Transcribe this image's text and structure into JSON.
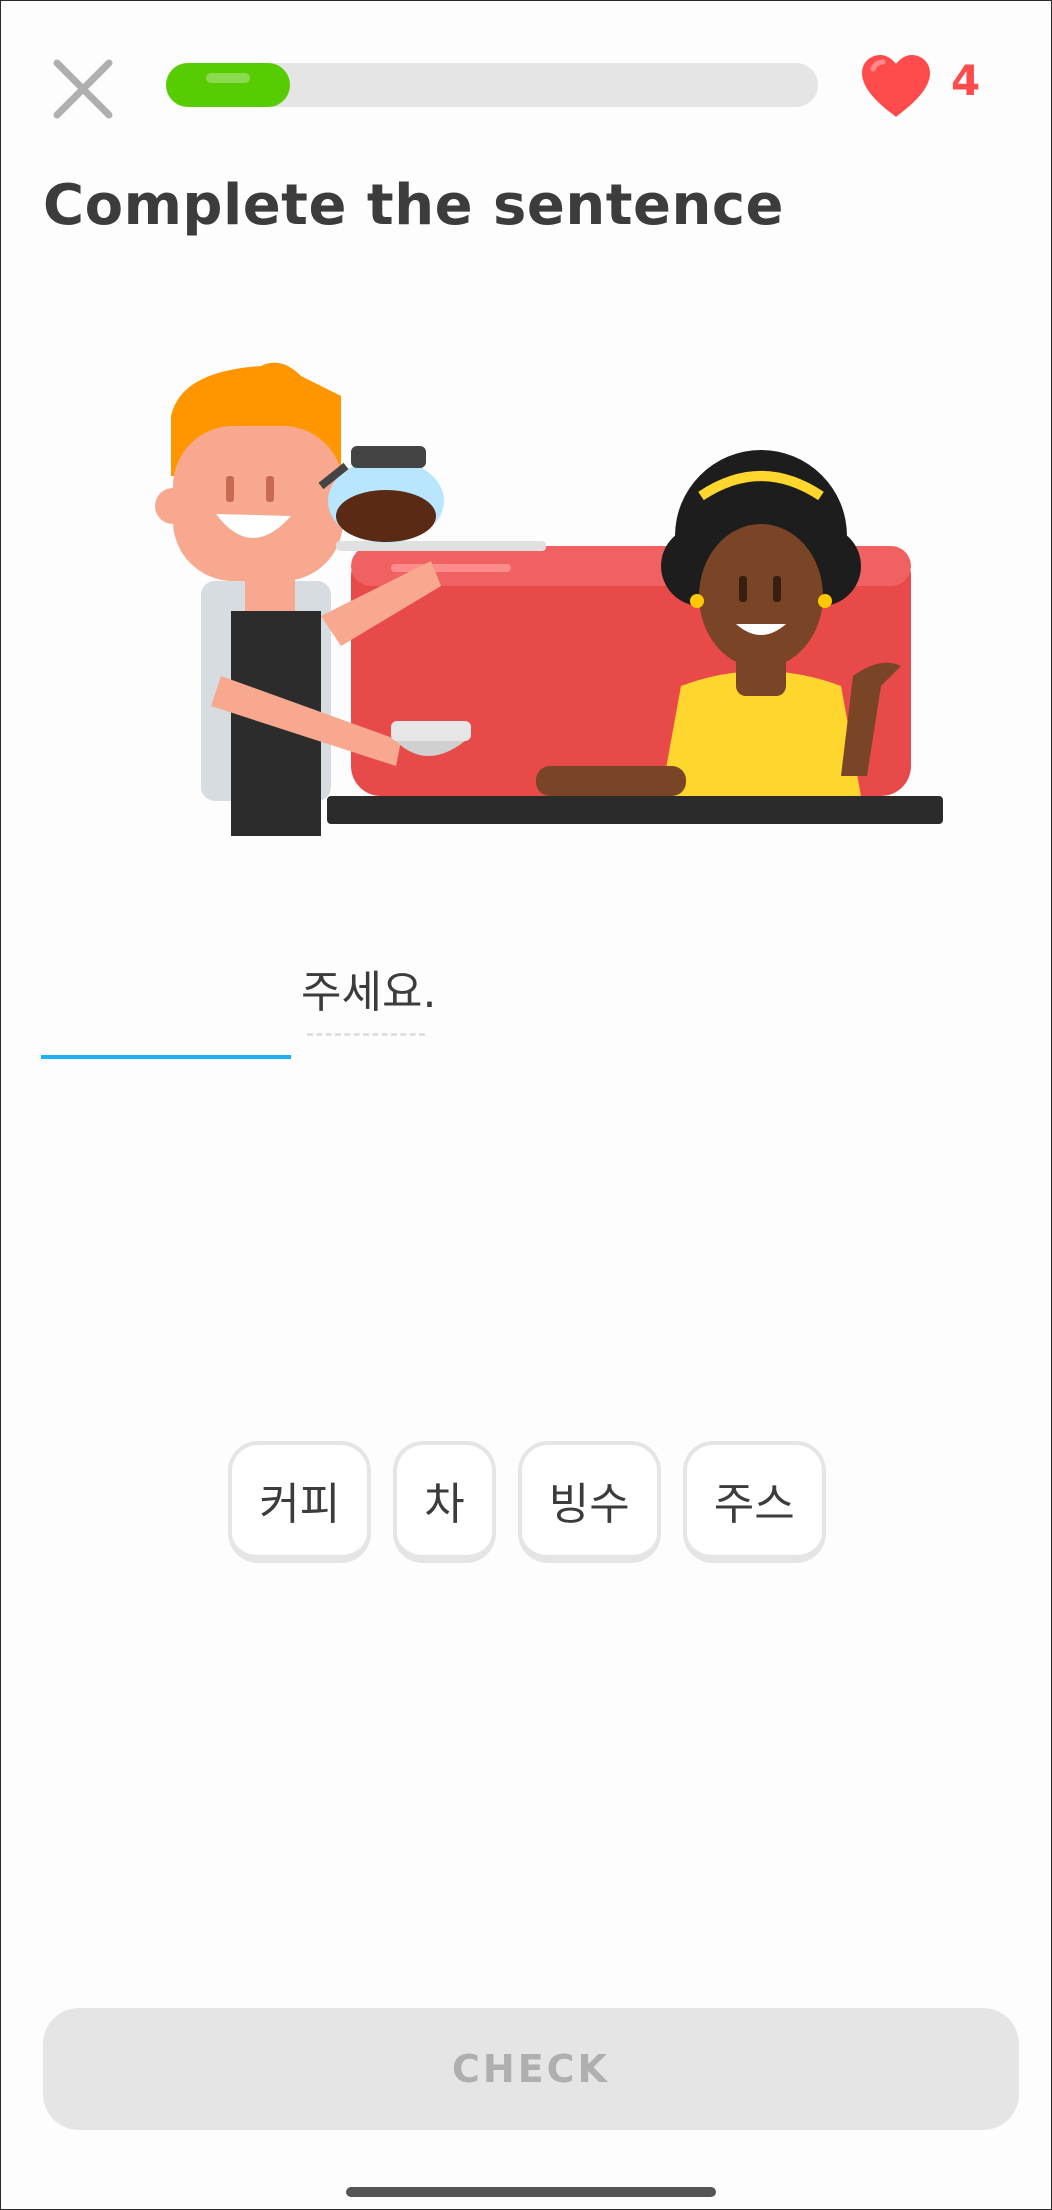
{
  "header": {
    "close_icon": "close-x-icon",
    "progress_fraction": 0.19,
    "hearts_count": "4",
    "heart_icon": "heart-icon"
  },
  "title": "Complete the sentence",
  "illustration": "cafe-scene-illustration",
  "sentence": {
    "blank_value": "",
    "word": "주세요."
  },
  "word_bank": [
    "커피",
    "차",
    "빙수",
    "주스"
  ],
  "check_label": "CHECK",
  "colors": {
    "progress": "#58cc02",
    "heart": "#ff4b4b",
    "blank_underline": "#1cb0f6",
    "text": "#3c3c3c",
    "check_disabled_bg": "#e5e5e5",
    "check_disabled_text": "#afafaf"
  }
}
